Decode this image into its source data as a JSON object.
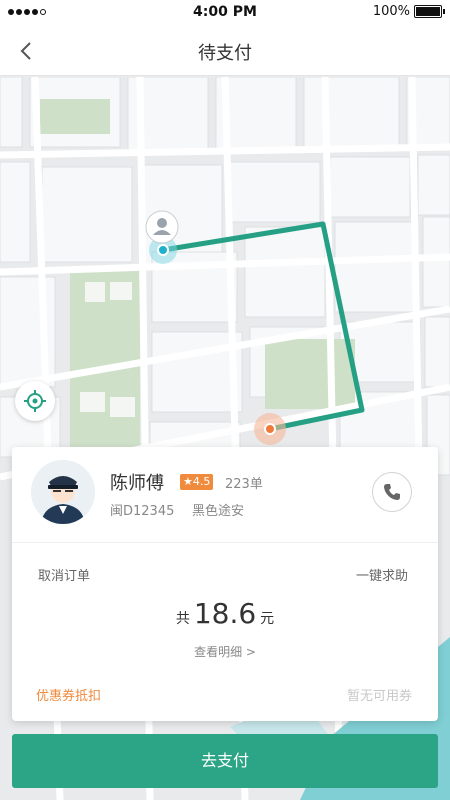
{
  "status_bar": {
    "time": "4:00 PM",
    "battery": "100%"
  },
  "nav": {
    "title": "待支付"
  },
  "driver": {
    "name": "陈师傅",
    "rating": "★4.5",
    "trips": "223单",
    "plate": "闽D12345",
    "car": "黑色途安"
  },
  "actions": {
    "cancel": "取消订单",
    "help": "一键求助"
  },
  "fare": {
    "prefix": "共",
    "amount": "18.6",
    "unit": "元",
    "detail": "查看明细 >"
  },
  "coupon": {
    "label": "优惠券抵扣",
    "status": "暂无可用券"
  },
  "pay_button": "去支付",
  "colors": {
    "accent": "#2ba585",
    "orange": "#f08a3c",
    "route": "#26a085"
  },
  "icons": [
    "back-icon",
    "locate-icon",
    "phone-icon",
    "user-pin-icon",
    "destination-pin-icon"
  ]
}
